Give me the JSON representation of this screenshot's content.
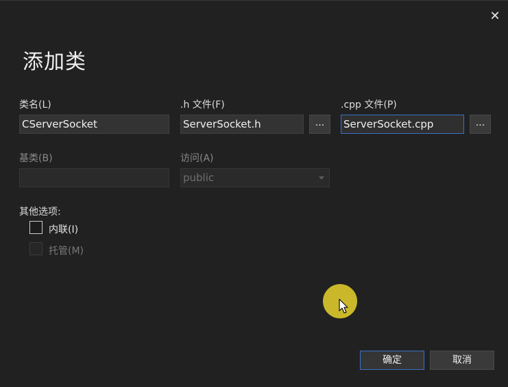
{
  "dialog": {
    "title": "添加类",
    "close_glyph": "✕"
  },
  "fields": {
    "class_name": {
      "label": "类名(L)",
      "value": "CServerSocket"
    },
    "h_file": {
      "label": ".h 文件(F)",
      "value": "ServerSocket.h",
      "browse": "..."
    },
    "cpp_file": {
      "label": ".cpp 文件(P)",
      "value": "ServerSocket.cpp",
      "browse": "..."
    },
    "base_class": {
      "label": "基类(B)",
      "value": ""
    },
    "access": {
      "label": "访问(A)",
      "value": "public"
    }
  },
  "options": {
    "label": "其他选项:",
    "inline": {
      "label": "内联(I)",
      "checked": false,
      "enabled": true
    },
    "managed": {
      "label": "托管(M)",
      "checked": false,
      "enabled": false
    }
  },
  "buttons": {
    "ok": "确定",
    "cancel": "取消"
  },
  "colors": {
    "background": "#212121",
    "accent_border": "#3a73c9",
    "cursor_highlight": "#d9c52b"
  },
  "icons": {
    "close": "close-icon",
    "dropdown": "chevron-down-icon",
    "cursor": "mouse-pointer-icon"
  }
}
